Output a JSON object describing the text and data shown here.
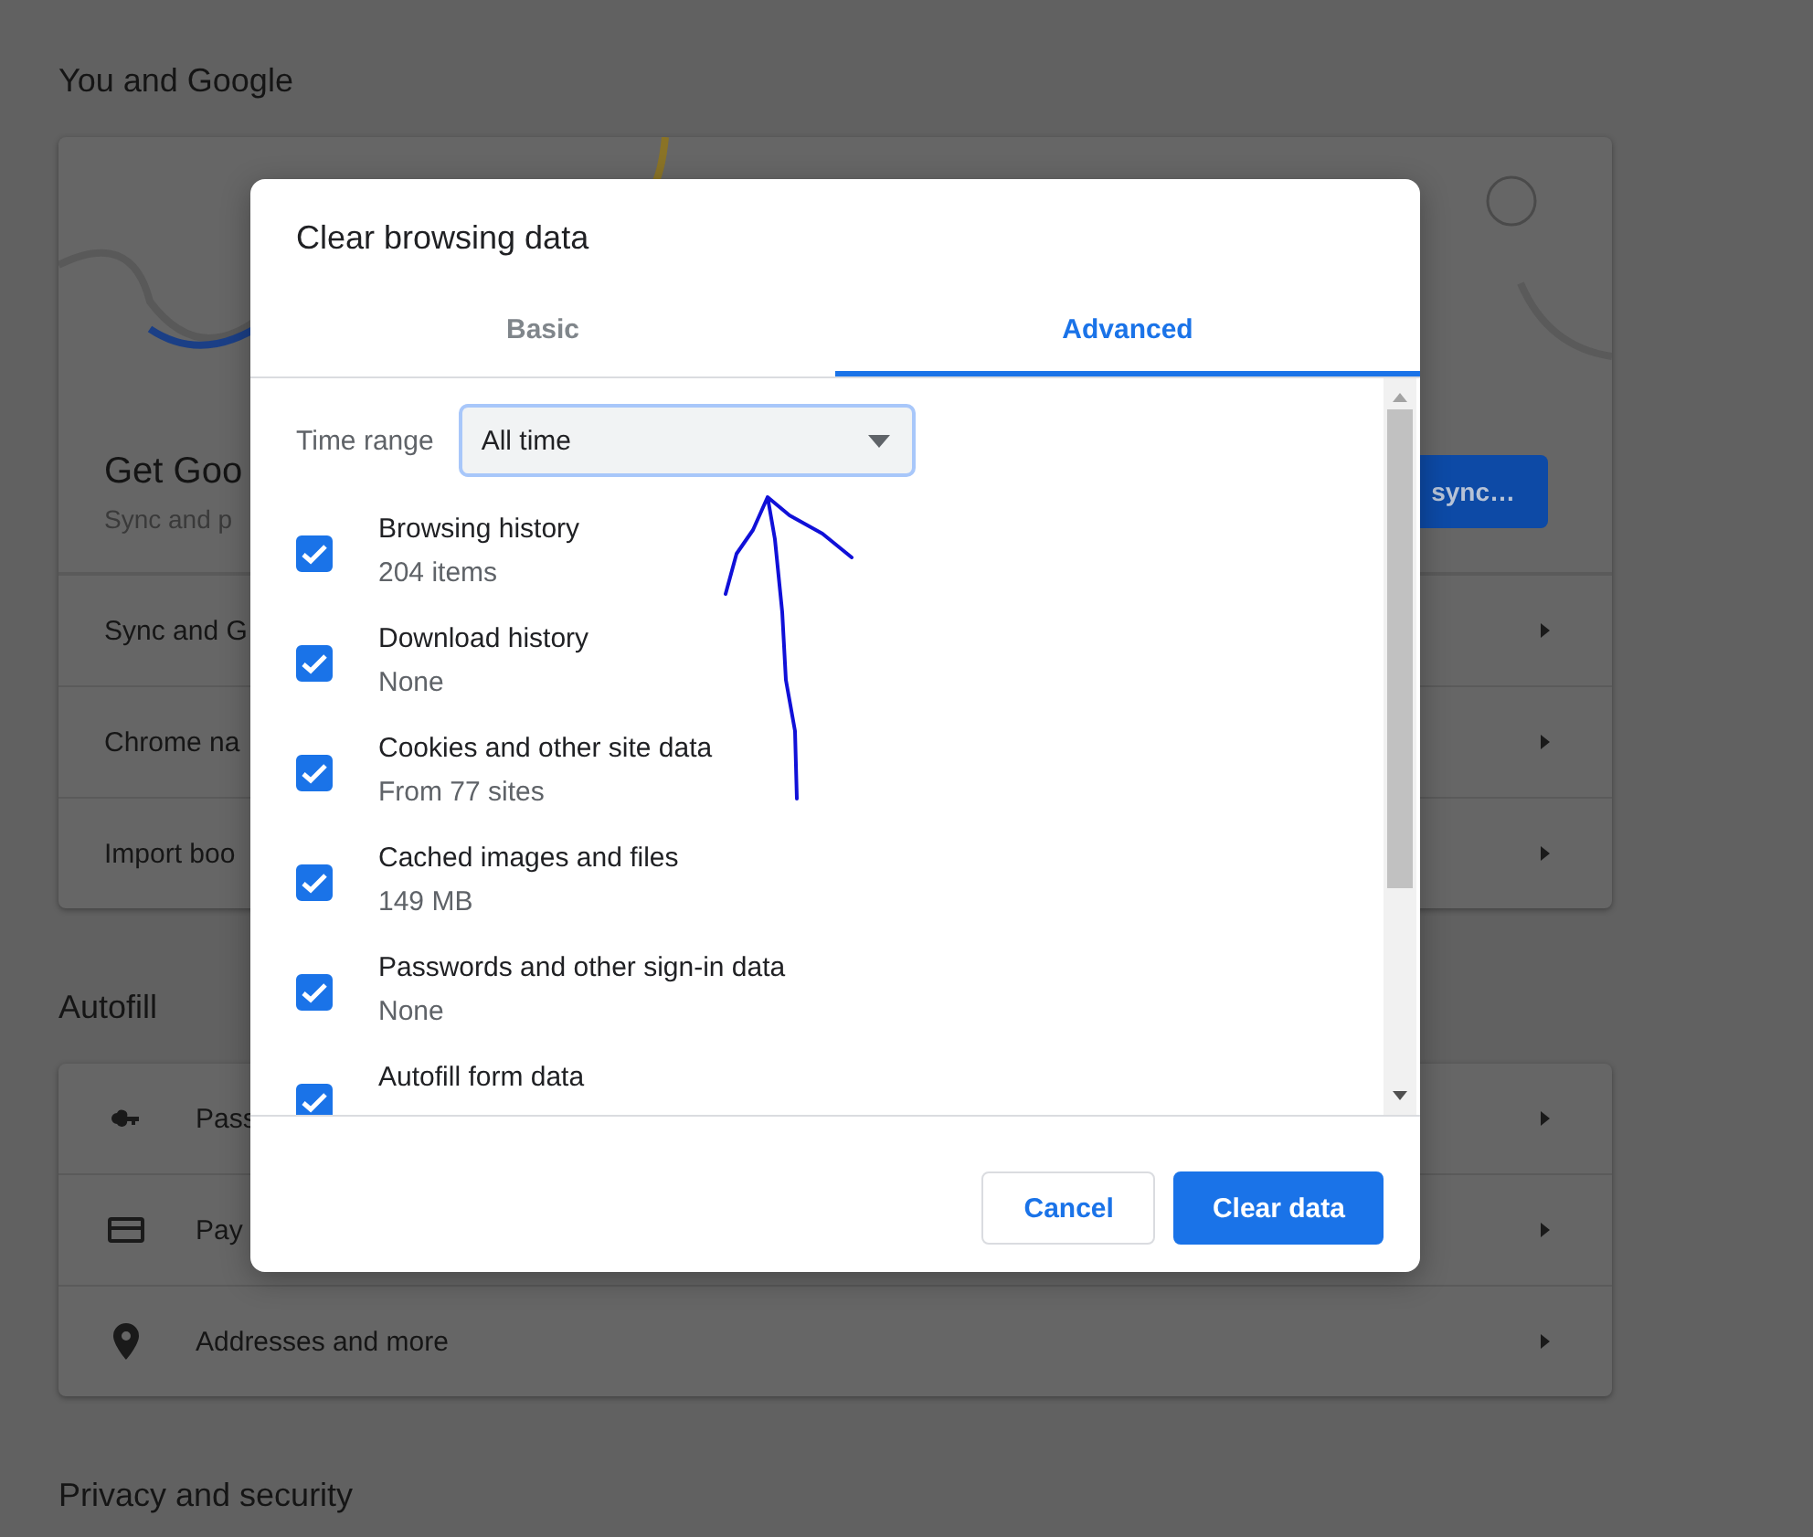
{
  "background_page": {
    "you_and_google": {
      "title": "You and Google",
      "profile": {
        "heading": "Get Goo",
        "subtitle": "Sync and p",
        "button": "sync…"
      },
      "rows": [
        {
          "label": "Sync and G"
        },
        {
          "label": "Chrome na"
        },
        {
          "label": "Import boo"
        }
      ]
    },
    "autofill": {
      "title": "Autofill",
      "rows": [
        {
          "label": "Pass"
        },
        {
          "label": "Pay"
        },
        {
          "label": "Addresses and more"
        }
      ]
    },
    "privacy_title": "Privacy and security"
  },
  "dialog": {
    "title": "Clear browsing data",
    "tabs": [
      {
        "label": "Basic",
        "selected": false
      },
      {
        "label": "Advanced",
        "selected": true
      }
    ],
    "time_range": {
      "label": "Time range",
      "value": "All time"
    },
    "items": [
      {
        "label": "Browsing history",
        "detail": "204 items",
        "checked": true
      },
      {
        "label": "Download history",
        "detail": "None",
        "checked": true
      },
      {
        "label": "Cookies and other site data",
        "detail": "From 77 sites",
        "checked": true
      },
      {
        "label": "Cached images and files",
        "detail": "149 MB",
        "checked": true
      },
      {
        "label": "Passwords and other sign-in data",
        "detail": "None",
        "checked": true
      },
      {
        "label": "Autofill form data",
        "checked": true
      }
    ],
    "buttons": [
      {
        "label": "Cancel",
        "kind": "secondary"
      },
      {
        "label": "Clear data",
        "kind": "primary"
      }
    ]
  }
}
